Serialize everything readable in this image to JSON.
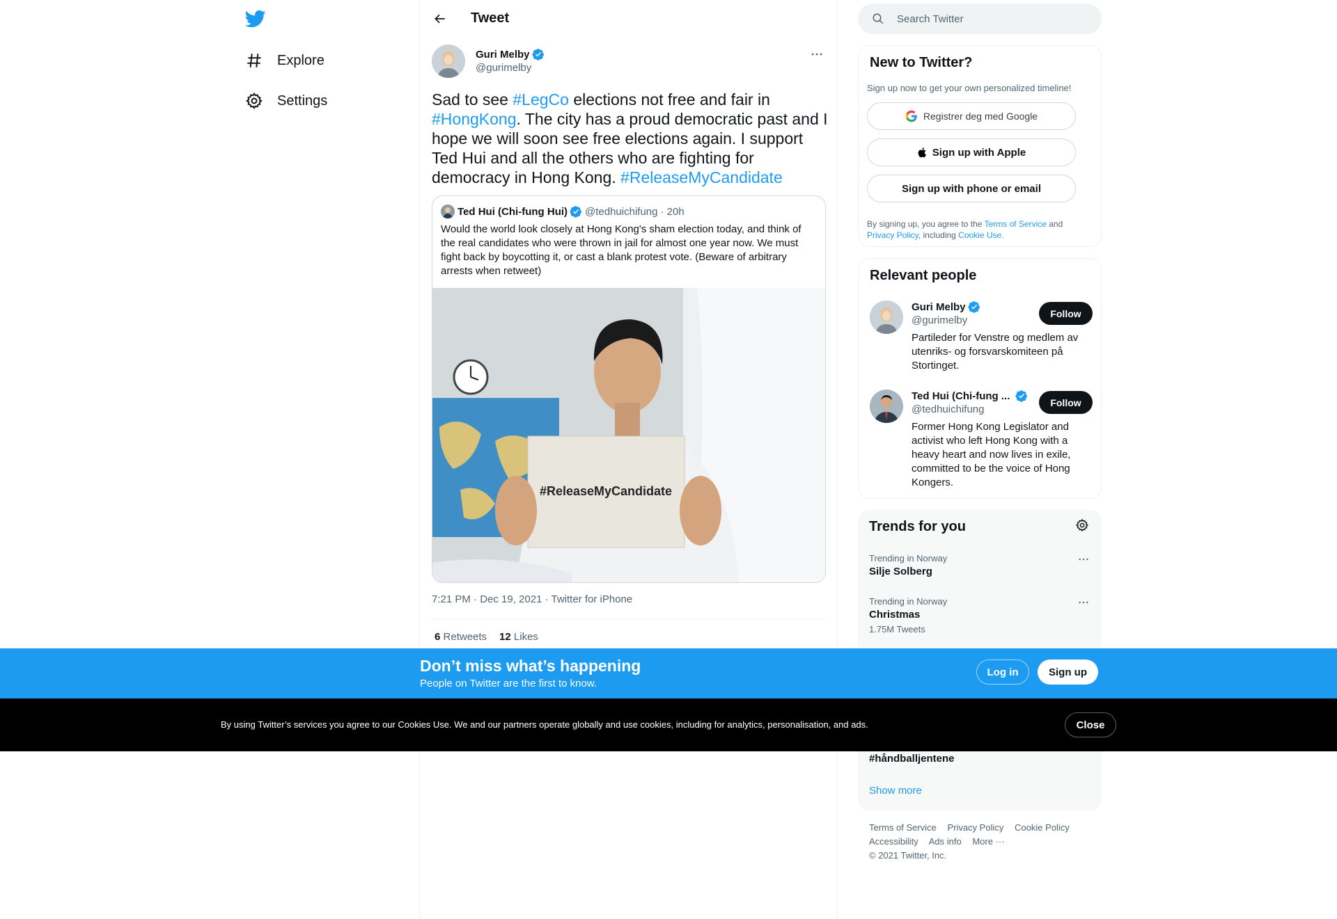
{
  "nav": {
    "items": [
      {
        "label": "Explore",
        "icon": "hashtag-icon"
      },
      {
        "label": "Settings",
        "icon": "gear-icon"
      }
    ]
  },
  "header": {
    "title": "Tweet"
  },
  "tweet": {
    "author_name": "Guri Melby",
    "author_handle": "@gurimelby",
    "text_parts": {
      "p1": "Sad to see ",
      "tag1": "#LegCo",
      "p2": " elections not free and fair in ",
      "tag2": "#HongKong",
      "p3": ". The city has a proud democratic past and I hope we will soon see free elections again. I support Ted Hui and all the others who are fighting for democracy in Hong Kong. ",
      "tag3": "#ReleaseMyCandidate"
    },
    "quote": {
      "name": "Ted Hui (Chi-fung Hui)",
      "handle": "@tedhuichifung",
      "time": "· 20h",
      "text": "Would the world look closely at Hong Kong's sham election today, and think of the real candidates who were thrown in jail for almost one year now. We must fight back by boycotting it, or cast a blank protest vote. (Beware of arbitrary arrests when retweet)",
      "image_sign_text": "#ReleaseMyCandidate"
    },
    "timestamp": "7:21 PM · Dec 19, 2021",
    "separator": " · ",
    "source": "Twitter for iPhone",
    "retweets_count": "6",
    "retweets_label": "Retweets",
    "likes_count": "12",
    "likes_label": "Likes"
  },
  "search": {
    "placeholder": "Search Twitter"
  },
  "new_to_twitter": {
    "title": "New to Twitter?",
    "subtitle": "Sign up now to get your own personalized timeline!",
    "google_label": "Registrer deg med Google",
    "apple_label": "Sign up with Apple",
    "phone_label": "Sign up with phone or email",
    "legal_1": "By signing up, you agree to the ",
    "terms": "Terms of Service",
    "legal_2": " and ",
    "privacy": "Privacy Policy",
    "legal_3": ", including ",
    "cookie": "Cookie Use."
  },
  "relevant": {
    "title": "Relevant people",
    "people": [
      {
        "name": "Guri Melby",
        "handle": "@gurimelby",
        "bio": "Partileder for Venstre og medlem av utenriks- og forsvarskomiteen på Stortinget.",
        "follow": "Follow"
      },
      {
        "name": "Ted Hui (Chi-fung ...",
        "handle": "@tedhuichifung",
        "bio": "Former Hong Kong Legislator and activist who left Hong Kong with a heavy heart and now lives in exile, committed to be the voice of Hong Kongers.",
        "follow": "Follow"
      }
    ]
  },
  "trends": {
    "title": "Trends for you",
    "items": [
      {
        "context": "Trending in Norway",
        "name": "Silje Solberg",
        "count": ""
      },
      {
        "context": "Trending in Norway",
        "name": "Christmas",
        "count": "1.75M Tweets"
      },
      {
        "context": "",
        "name": "#håndballjentene",
        "count": ""
      }
    ],
    "show_more": "Show more"
  },
  "footer": {
    "row1": [
      "Terms of Service",
      "Privacy Policy",
      "Cookie Policy"
    ],
    "row2": [
      "Accessibility",
      "Ads info",
      "More ···"
    ],
    "copyright": "© 2021 Twitter, Inc."
  },
  "banner": {
    "title": "Don’t miss what’s happening",
    "subtitle": "People on Twitter are the first to know.",
    "login": "Log in",
    "signup": "Sign up"
  },
  "cookie_bar": {
    "text": "By using Twitter’s services you agree to our Cookies Use. We and our partners operate globally and use cookies, including for analytics, personalisation, and ads.",
    "close": "Close"
  },
  "colors": {
    "accent": "#1d9bf0",
    "text": "#0f1419",
    "muted": "#536471"
  }
}
